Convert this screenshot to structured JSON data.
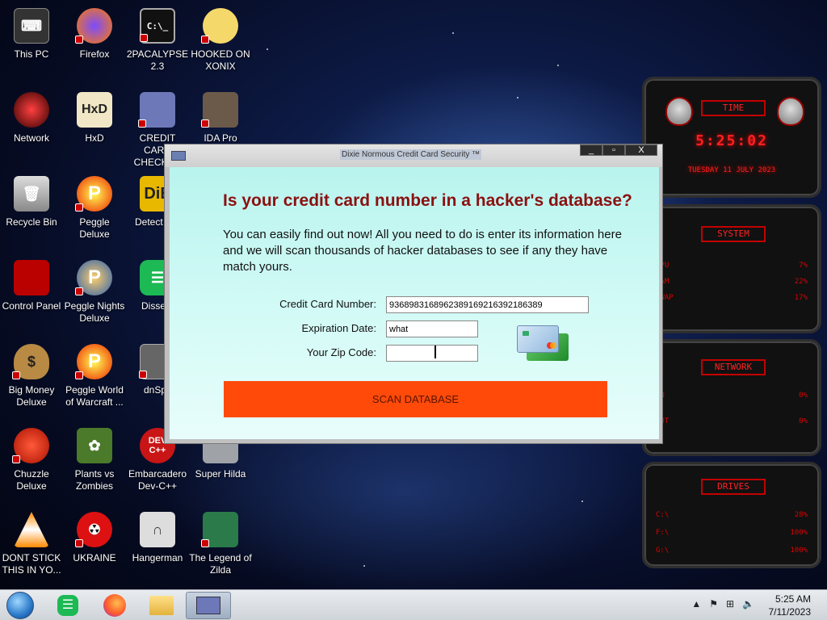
{
  "desktop_icons": [
    {
      "label": "This PC"
    },
    {
      "label": "Firefox"
    },
    {
      "label": "2PACALYPSE 2.3"
    },
    {
      "label": "HOOKED ON XONIX"
    },
    {
      "label": "Network"
    },
    {
      "label": "HxD"
    },
    {
      "label": "CREDIT CARD CHECKER"
    },
    {
      "label": "IDA Pro"
    },
    {
      "label": "Recycle Bin"
    },
    {
      "label": "Peggle Deluxe"
    },
    {
      "label": "Detect It E"
    },
    {
      "label": "Control Panel"
    },
    {
      "label": "Peggle Nights Deluxe"
    },
    {
      "label": "Dissent"
    },
    {
      "label": "Big Money Deluxe"
    },
    {
      "label": "Peggle World of Warcraft ..."
    },
    {
      "label": "dnSpy"
    },
    {
      "label": "Chuzzle Deluxe"
    },
    {
      "label": "Plants vs Zombies"
    },
    {
      "label": "Embarcadero Dev-C++"
    },
    {
      "label": "Super Hilda"
    },
    {
      "label": "DONT STICK THIS IN YO..."
    },
    {
      "label": "UKRAINE"
    },
    {
      "label": "Hangerman"
    },
    {
      "label": "The Legend of Zilda"
    }
  ],
  "widgets": {
    "time": {
      "header": "TIME",
      "clock": "5:25:02",
      "date": "TUESDAY 11 JULY 2023"
    },
    "system": {
      "header": "SYSTEM",
      "rows": [
        {
          "name": "CPU",
          "value": "7%"
        },
        {
          "name": "RAM",
          "value": "22%"
        },
        {
          "name": "SWAP",
          "value": "17%"
        }
      ]
    },
    "network": {
      "header": "NETWORK",
      "rows": [
        {
          "name": "IN",
          "value": "0%"
        },
        {
          "name": "OUT",
          "value": "0%"
        }
      ]
    },
    "drives": {
      "header": "DRIVES",
      "rows": [
        {
          "name": "C:\\",
          "value": "28%"
        },
        {
          "name": "F:\\",
          "value": "100%"
        },
        {
          "name": "G:\\",
          "value": "100%"
        }
      ]
    }
  },
  "dialog": {
    "title": "Dixie Normous Credit Card Security ™",
    "headline": "Is your credit card number in a hacker's database?",
    "description": "You can easily find out now! All you need to do is enter its information here and we will scan thousands of hacker databases to see if any they have match yours.",
    "card_number_label": "Credit Card Number:",
    "card_number_value": "9368983168962389169216392186389",
    "expiration_label": "Expiration Date:",
    "expiration_value": "what",
    "zip_label": "Your Zip Code:",
    "zip_value": "",
    "scan_button": "SCAN DATABASE",
    "controls": {
      "minimize": "_",
      "maximize": "▫",
      "close": "X"
    }
  },
  "taskbar": {
    "time": "5:25 AM",
    "date": "7/11/2023",
    "pinned": [
      "start",
      "dissent",
      "firefox",
      "explorer",
      "credit-card-checker"
    ]
  }
}
